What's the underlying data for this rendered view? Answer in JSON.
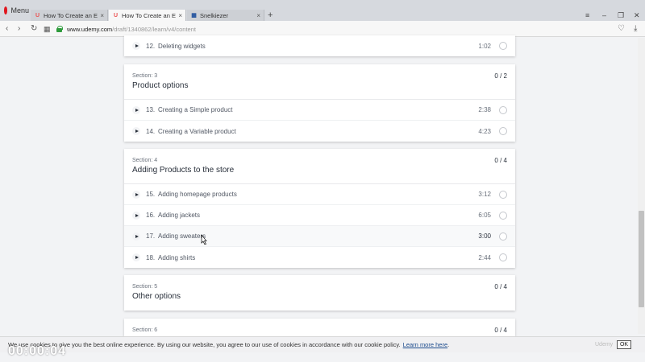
{
  "browser": {
    "menu_label": "Menu",
    "tabs": [
      {
        "title": "How To Create an Ecomm",
        "active": false,
        "favicon": "udemy-favicon"
      },
      {
        "title": "How To Create an Ecomm",
        "active": true,
        "favicon": "udemy-favicon"
      },
      {
        "title": "Snelkiezer",
        "active": false,
        "favicon": "grid-favicon"
      }
    ],
    "url_host": "www.udemy.com",
    "url_path": "/draft/1340862/learn/v4/content"
  },
  "sections": [
    {
      "label": "",
      "title": "",
      "count": "",
      "lectures": [
        {
          "num": "12.",
          "title": "Deleting widgets",
          "duration": "1:02"
        }
      ]
    },
    {
      "label": "Section: 3",
      "title": "Product options",
      "count": "0 / 2",
      "lectures": [
        {
          "num": "13.",
          "title": "Creating a Simple product",
          "duration": "2:38"
        },
        {
          "num": "14.",
          "title": "Creating a Variable product",
          "duration": "4:23"
        }
      ]
    },
    {
      "label": "Section: 4",
      "title": "Adding Products to the store",
      "count": "0 / 4",
      "lectures": [
        {
          "num": "15.",
          "title": "Adding homepage products",
          "duration": "3:12"
        },
        {
          "num": "16.",
          "title": "Adding jackets",
          "duration": "6:05"
        },
        {
          "num": "17.",
          "title": "Adding sweaters",
          "duration": "3:00"
        },
        {
          "num": "18.",
          "title": "Adding shirts",
          "duration": "2:44"
        }
      ]
    },
    {
      "label": "Section: 5",
      "title": "Other options",
      "count": "0 / 4",
      "lectures": []
    },
    {
      "label": "Section: 6",
      "title": "",
      "count": "0 / 4",
      "lectures": []
    }
  ],
  "cookie": {
    "prefix": "We use cookies to give you the best online experience. By using our website, you agree to our use of cookies in accordance with our cookie policy.",
    "link": "Learn more here",
    "suffix": ".",
    "ok_label": "OK"
  },
  "overlay": {
    "digits": "00:00:04",
    "watermark": "Udemy"
  },
  "colors": {
    "accent": "#ec5252",
    "text": "#29303b"
  }
}
